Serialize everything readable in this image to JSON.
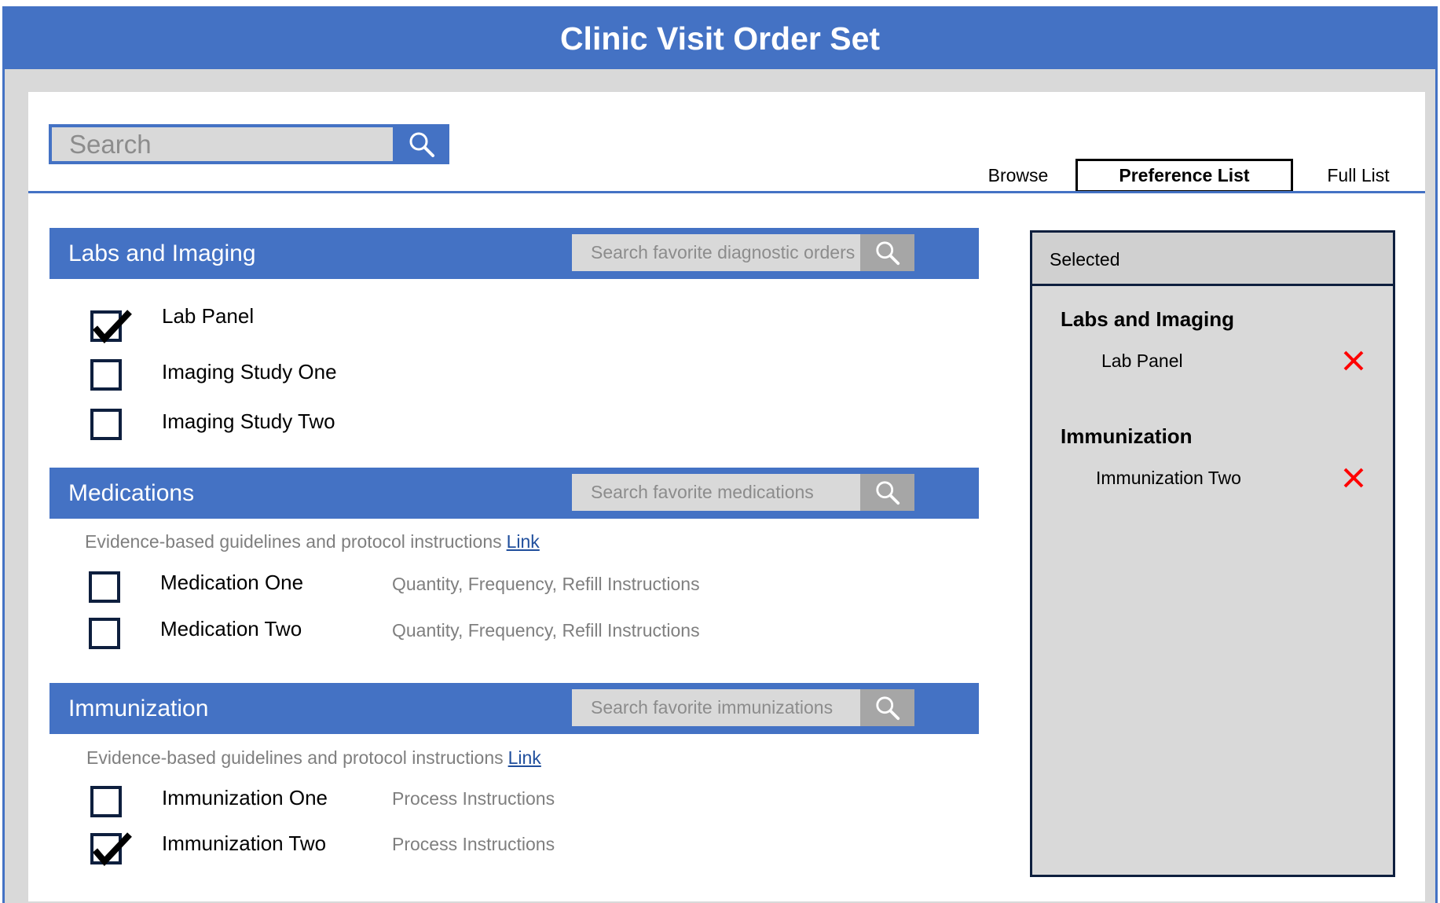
{
  "window": {
    "title": "Clinic Visit Order Set"
  },
  "search": {
    "placeholder": "Search"
  },
  "tabs": {
    "browse": "Browse",
    "preference": "Preference List",
    "full": "Full List"
  },
  "sections": {
    "labs": {
      "title": "Labs and Imaging",
      "search_placeholder": "Search favorite diagnostic orders",
      "items": [
        {
          "label": "Lab Panel",
          "checked": true
        },
        {
          "label": "Imaging Study One",
          "checked": false
        },
        {
          "label": "Imaging Study Two",
          "checked": false
        }
      ]
    },
    "medications": {
      "title": "Medications",
      "search_placeholder": "Search favorite medications",
      "guidelines": "Evidence-based guidelines and protocol instructions",
      "link": "Link",
      "items": [
        {
          "label": "Medication One",
          "note": "Quantity, Frequency, Refill Instructions",
          "checked": false
        },
        {
          "label": "Medication Two",
          "note": "Quantity, Frequency, Refill Instructions",
          "checked": false
        }
      ]
    },
    "immunization": {
      "title": "Immunization",
      "search_placeholder": "Search favorite immunizations",
      "guidelines": "Evidence-based guidelines and protocol instructions",
      "link": "Link",
      "items": [
        {
          "label": "Immunization One",
          "note": "Process Instructions",
          "checked": false
        },
        {
          "label": "Immunization Two",
          "note": "Process Instructions",
          "checked": true
        }
      ]
    }
  },
  "selected": {
    "header": "Selected",
    "groups": [
      {
        "title": "Labs and Imaging",
        "items": [
          "Lab Panel"
        ]
      },
      {
        "title": "Immunization",
        "items": [
          "Immunization Two"
        ]
      }
    ]
  },
  "icons": {
    "search": "search-icon",
    "check": "checkmark-icon",
    "remove": "remove-x-icon"
  },
  "colors": {
    "primary": "#4472c4",
    "panel": "#d9d9d9",
    "remove": "#ff0000",
    "border": "#0e1f3e"
  }
}
